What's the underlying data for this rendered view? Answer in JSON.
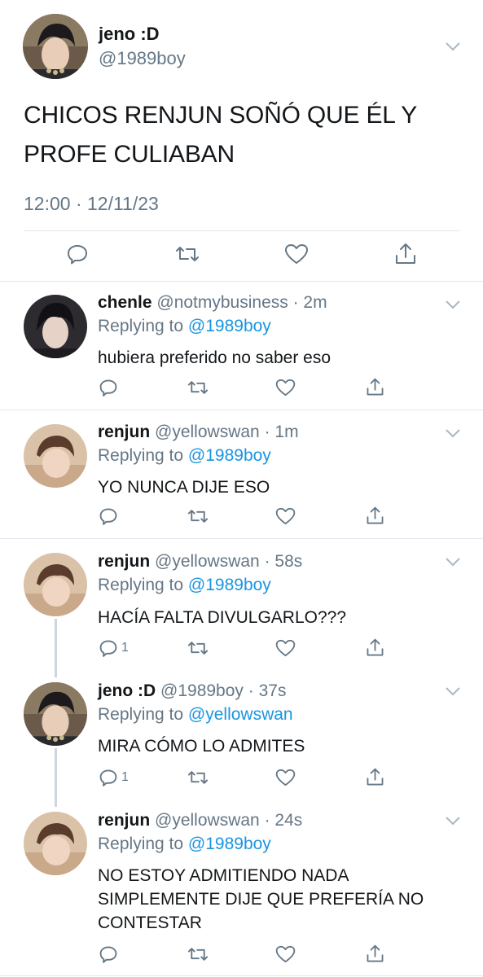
{
  "main_tweet": {
    "name": "jeno :D",
    "handle": "@1989boy",
    "text": "CHICOS RENJUN SOÑÓ QUE ÉL Y PROFE CULIABAN",
    "timestamp": "12:00 · 12/11/23",
    "actions": [
      "reply-icon",
      "retweet-icon",
      "like-icon",
      "share-icon"
    ]
  },
  "replies": [
    {
      "name": "chenle",
      "handle": "@notmybusiness",
      "time": "· 2m",
      "replying_prefix": "Replying to ",
      "replying_to": "@1989boy",
      "text": "hubiera preferido no saber eso",
      "reply_count": ""
    },
    {
      "name": "renjun",
      "handle": "@yellowswan",
      "time": "· 1m",
      "replying_prefix": "Replying to ",
      "replying_to": "@1989boy",
      "text": "YO NUNCA DIJE ESO",
      "reply_count": ""
    },
    {
      "name": "renjun",
      "handle": "@yellowswan",
      "time": "· 58s",
      "replying_prefix": "Replying to ",
      "replying_to": "@1989boy",
      "text": "HACÍA FALTA DIVULGARLO???",
      "reply_count": "1"
    },
    {
      "name": "jeno :D",
      "handle": "@1989boy",
      "time": "· 37s",
      "replying_prefix": "Replying to ",
      "replying_to": "@yellowswan",
      "text": "MIRA CÓMO LO ADMITES",
      "reply_count": "1"
    },
    {
      "name": "renjun",
      "handle": "@yellowswan",
      "time": "· 24s",
      "replying_prefix": "Replying to ",
      "replying_to": "@1989boy",
      "text": "NO ESTOY ADMITIENDO NADA SIMPLEMENTE DIJE QUE PREFERÍA NO CONTESTAR",
      "reply_count": ""
    }
  ],
  "colors": {
    "text": "#14171a",
    "secondary": "#657786",
    "link": "#1b95e0",
    "divider": "#e1e8ed",
    "thread_line": "#ccd6dd"
  }
}
